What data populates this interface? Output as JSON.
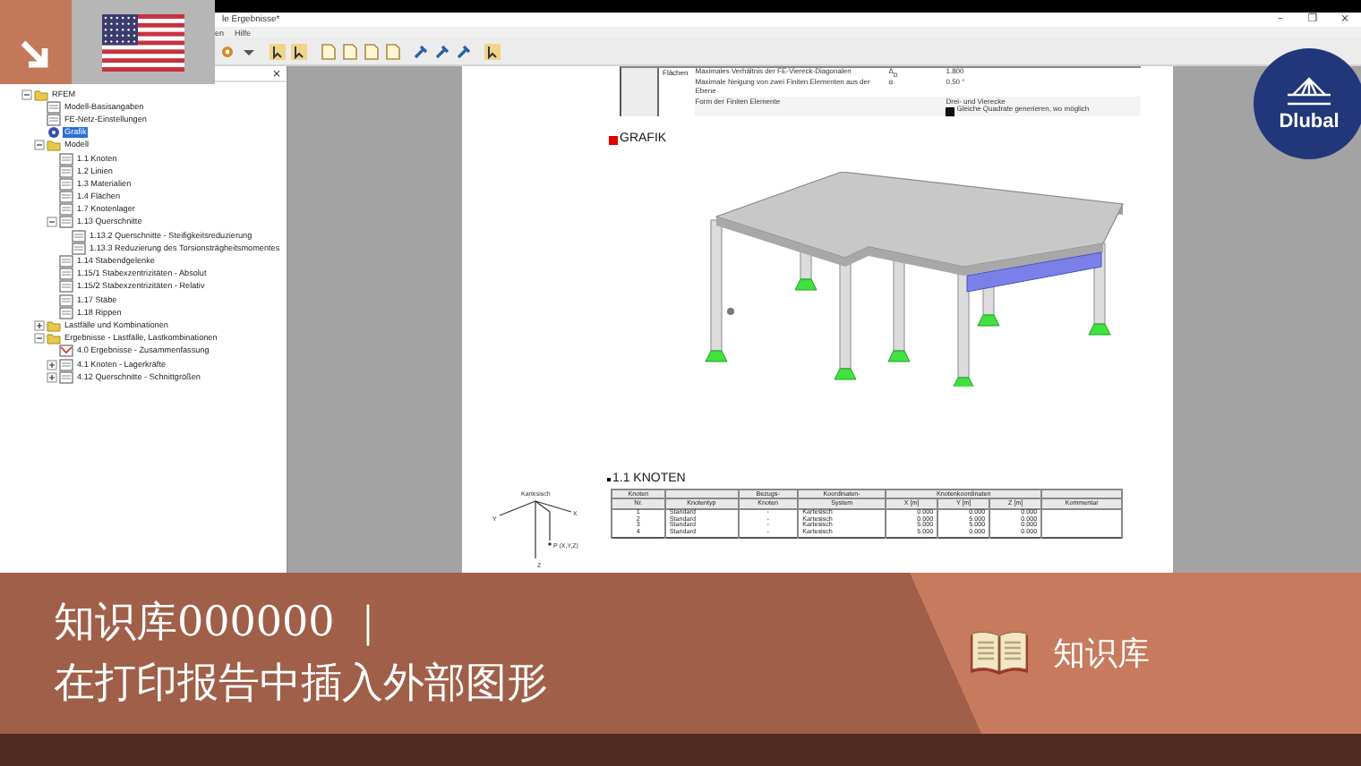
{
  "window": {
    "title": "le Ergebnisse*",
    "controls": [
      "–",
      "❐",
      "×"
    ]
  },
  "menu": [
    "en",
    "Hilfe"
  ],
  "navigator": {
    "close": "×",
    "tree": [
      {
        "label": "RFEM",
        "kind": "folder",
        "expanded": true,
        "selected": false,
        "children": [
          {
            "label": "Modell-Basisangaben",
            "kind": "page",
            "selected": false
          },
          {
            "label": "FE-Netz-Einstellungen",
            "kind": "page",
            "selected": false
          },
          {
            "label": "Grafik",
            "kind": "graphic",
            "selected": true
          },
          {
            "label": "Modell",
            "kind": "folder",
            "expanded": true,
            "selected": false,
            "children": [
              {
                "label": "1.1 Knoten",
                "kind": "page",
                "selected": false
              },
              {
                "label": "1.2 Linien",
                "kind": "page",
                "selected": false
              },
              {
                "label": "1.3 Materialien",
                "kind": "page",
                "selected": false
              },
              {
                "label": "1.4 Flächen",
                "kind": "page",
                "selected": false
              },
              {
                "label": "1.7 Knotenlager",
                "kind": "page",
                "selected": false
              },
              {
                "label": "1.13 Querschnitte",
                "kind": "page",
                "expanded": true,
                "selected": false,
                "children": [
                  {
                    "label": "1.13.2 Querschnitte - Steifigkeitsreduzierung",
                    "kind": "page",
                    "selected": false
                  },
                  {
                    "label": "1.13.3 Reduzierung des Torsionsträgheitsmomentes",
                    "kind": "page",
                    "selected": false
                  }
                ]
              },
              {
                "label": "1.14 Stabendgelenke",
                "kind": "page",
                "selected": false
              },
              {
                "label": "1.15/1 Stabexzentrizitäten - Absolut",
                "kind": "page",
                "selected": false
              },
              {
                "label": "1.15/2 Stabexzentrizitäten - Relativ",
                "kind": "page",
                "selected": false
              },
              {
                "label": "1.17 Stäbe",
                "kind": "page",
                "selected": false
              },
              {
                "label": "1.18 Rippen",
                "kind": "page",
                "selected": false
              }
            ]
          },
          {
            "label": "Lastfälle und Kombinationen",
            "kind": "folder",
            "expanded": false,
            "selected": false
          },
          {
            "label": "Ergebnisse - Lastfälle, Lastkombinationen",
            "kind": "folder",
            "expanded": true,
            "selected": false,
            "children": [
              {
                "label": "4.0 Ergebnisse - Zusammenfassung",
                "kind": "results",
                "selected": false
              },
              {
                "label": "4.1 Knoten - Lagerkräfte",
                "kind": "page",
                "expanded": false,
                "selected": false
              },
              {
                "label": "4.12 Querschnitte - Schnittgrößen",
                "kind": "page",
                "expanded": false,
                "selected": false
              }
            ]
          }
        ]
      }
    ]
  },
  "report": {
    "settings": {
      "category": "Flächen",
      "rows": [
        {
          "label": "Maximales Verhältnis der FE-Viereck-Diagonalen",
          "symbol": "Δ$_{D}$",
          "value": "1.800"
        },
        {
          "label": "Maximale Neigung von zwei Finiten Elementen aus der Ebene",
          "symbol": "α",
          "value": "0.50 °"
        },
        {
          "label": "Form der Finiten Elemente",
          "value": "Drei- und Vierecke",
          "option": "Gleiche Quadrate generieren, wo möglich",
          "checked": true
        }
      ]
    },
    "figure_heading": "GRAFIK",
    "axes": {
      "title": "Kartesisch",
      "x": "X",
      "y": "Y",
      "z": "Z",
      "point": "P (X,Y,Z)"
    },
    "nodes_heading": "1.1 KNOTEN",
    "table": {
      "columns": [
        {
          "top": "Knoten",
          "label": "Nr."
        },
        {
          "label": "Knotentyp"
        },
        {
          "top": "Bezugs-",
          "label": "Knoten"
        },
        {
          "top": "Koordinaten-",
          "label": "System"
        },
        {
          "top": "Knotenkoordinaten",
          "colspan": 3,
          "children": [
            {
              "label": "X [m]"
            },
            {
              "label": "Y [m]"
            },
            {
              "label": "Z [m]"
            }
          ]
        },
        {
          "label": "Kommentar"
        }
      ],
      "rows": [
        [
          "1",
          "Standard",
          "-",
          "Kartesisch",
          "0.000",
          "0.000",
          "0.000"
        ],
        [
          "2",
          "Standard",
          "-",
          "Kartesisch",
          "0.000",
          "5.000",
          "0.000"
        ],
        [
          "3",
          "Standard",
          "-",
          "Kartesisch",
          "5.000",
          "5.000",
          "0.000"
        ],
        [
          "4",
          "Standard",
          "-",
          "Kartesisch",
          "5.000",
          "0.000",
          "0.000"
        ]
      ]
    }
  },
  "logo": {
    "text": "Dlubal"
  },
  "banner": {
    "title": "知识库000000 ｜",
    "subtitle": "在打印报告中插入外部图形",
    "tag": "知识库"
  }
}
